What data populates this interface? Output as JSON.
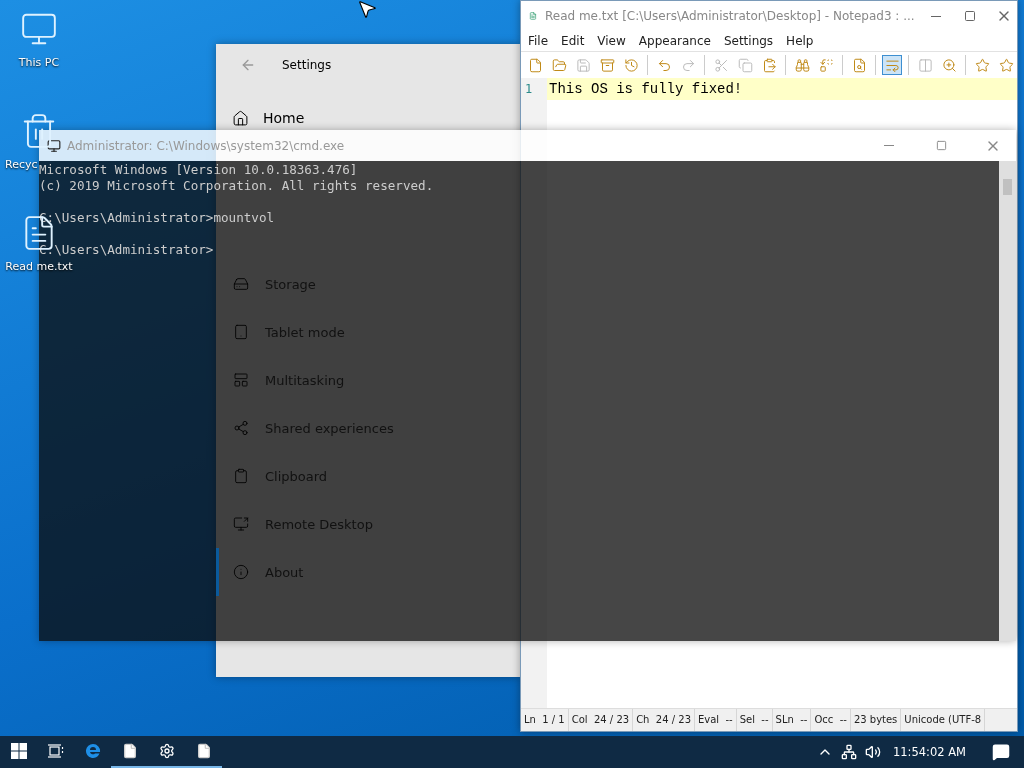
{
  "desktop_icons": [
    {
      "label": "This PC",
      "kind": "pc"
    },
    {
      "label": "Recyc",
      "kind": "bin"
    },
    {
      "label": "Read me.txt",
      "kind": "file"
    }
  ],
  "settings": {
    "title": "Settings",
    "home": "Home",
    "items": [
      {
        "label": "Storage",
        "kind": "storage",
        "selected": false
      },
      {
        "label": "Tablet mode",
        "kind": "tablet",
        "selected": false
      },
      {
        "label": "Multitasking",
        "kind": "multitask",
        "selected": false
      },
      {
        "label": "Shared experiences",
        "kind": "shared",
        "selected": false
      },
      {
        "label": "Clipboard",
        "kind": "clipboard",
        "selected": false
      },
      {
        "label": "Remote Desktop",
        "kind": "remote",
        "selected": false
      },
      {
        "label": "About",
        "kind": "about",
        "selected": true
      }
    ]
  },
  "notepad": {
    "title": "Read me.txt [C:\\Users\\Administrator\\Desktop] - Notepad3 : ...",
    "menu": [
      "File",
      "Edit",
      "View",
      "Appearance",
      "Settings",
      "Help"
    ],
    "toolbar": [
      {
        "kind": "new",
        "disabled": false,
        "on": false
      },
      {
        "kind": "open",
        "disabled": false,
        "on": false
      },
      {
        "kind": "save",
        "disabled": true,
        "on": false
      },
      {
        "kind": "saveas",
        "disabled": false,
        "on": false
      },
      {
        "kind": "revert",
        "disabled": false,
        "on": false
      },
      {
        "kind": "sep"
      },
      {
        "kind": "undo",
        "disabled": false,
        "on": false
      },
      {
        "kind": "redo",
        "disabled": true,
        "on": false
      },
      {
        "kind": "sep"
      },
      {
        "kind": "cut",
        "disabled": true,
        "on": false
      },
      {
        "kind": "copy",
        "disabled": true,
        "on": false
      },
      {
        "kind": "paste",
        "disabled": false,
        "on": false
      },
      {
        "kind": "sep"
      },
      {
        "kind": "find",
        "disabled": false,
        "on": false
      },
      {
        "kind": "replace",
        "disabled": false,
        "on": false
      },
      {
        "kind": "sep"
      },
      {
        "kind": "search",
        "disabled": false,
        "on": false
      },
      {
        "kind": "sep"
      },
      {
        "kind": "wrap",
        "disabled": false,
        "on": true
      },
      {
        "kind": "sep"
      },
      {
        "kind": "columns",
        "disabled": true,
        "on": false
      },
      {
        "kind": "zoom",
        "disabled": false,
        "on": false
      },
      {
        "kind": "sep"
      },
      {
        "kind": "star",
        "disabled": false,
        "on": false
      },
      {
        "kind": "staradd",
        "disabled": false,
        "on": false
      }
    ],
    "lines": [
      {
        "number": "1",
        "text": "This OS is fully fixed!"
      }
    ],
    "status": [
      "Ln  1 / 1",
      "Col  24 / 23",
      "Ch  24 / 23",
      "Eval  --",
      "Sel  --",
      "SLn  --",
      "Occ  --",
      "23 bytes",
      "Unicode (UTF-8"
    ]
  },
  "cmd": {
    "title": "Administrator: C:\\Windows\\system32\\cmd.exe",
    "blocks": [
      [
        "Microsoft Windows [Version 10.0.18363.476]",
        "(c) 2019 Microsoft Corporation. All rights reserved."
      ],
      [
        "C:\\Users\\Administrator>mountvol"
      ],
      [
        "C:\\Users\\Administrator>"
      ]
    ]
  },
  "taskbar": {
    "apps": [
      {
        "kind": "start",
        "open": false
      },
      {
        "kind": "taskview",
        "open": false
      },
      {
        "kind": "edge",
        "open": false
      },
      {
        "kind": "file",
        "open": true
      },
      {
        "kind": "gear",
        "open": true
      },
      {
        "kind": "file",
        "open": true
      }
    ],
    "clock": "11:54:02 AM"
  }
}
